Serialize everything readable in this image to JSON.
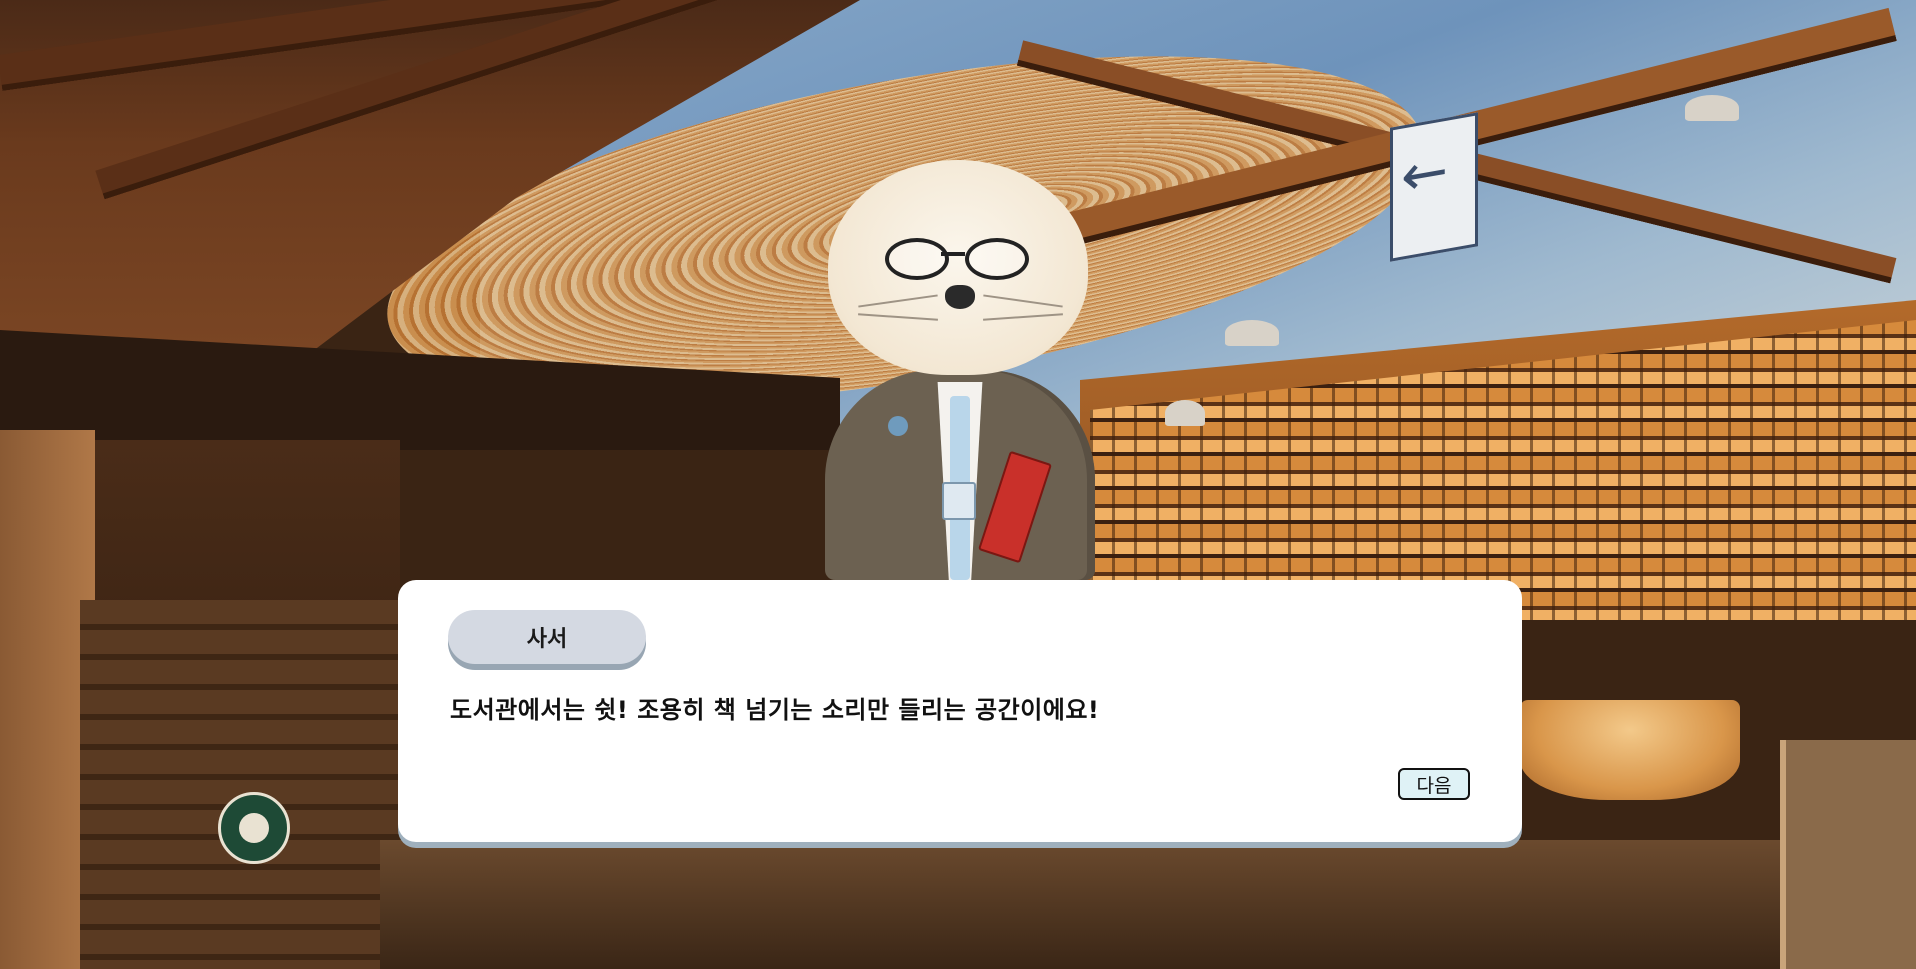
{
  "scene": {
    "background": "library",
    "colors": {
      "dialog_bg": "#ffffff",
      "speaker_tag_bg": "#d4d9e2",
      "next_button_bg": "#dff2f6"
    }
  },
  "character": {
    "icon": "otter-librarian"
  },
  "dialog": {
    "speaker": "사서",
    "text": "도서관에서는 쉿! 조용히 책 넘기는 소리만 들리는 공간이에요!",
    "next_label": "다음"
  }
}
